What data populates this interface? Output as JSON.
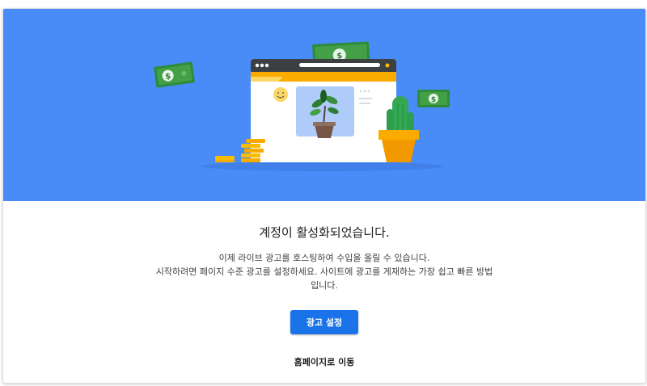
{
  "hero": {
    "background_color": "#4a8cf7",
    "illustration": [
      "money-bill-icon",
      "browser-window-icon",
      "smiley-avatar-icon",
      "plant-pot-icon",
      "cactus-icon",
      "coin-stack-icon"
    ]
  },
  "main": {
    "title": "계정이 활성화되었습니다.",
    "description_lines": [
      "이제 라이브 광고를 호스팅하여 수입을 올릴 수 있습니다.",
      "시작하려면 페이지 수준 광고를 설정하세요. 사이트에 광고를 게재하는 가장 쉽고 빠른 방법",
      "입니다."
    ],
    "primary_button_label": "광고 설정",
    "home_link_label": "홈페이지로 이동",
    "accent_color": "#1a73e8"
  }
}
